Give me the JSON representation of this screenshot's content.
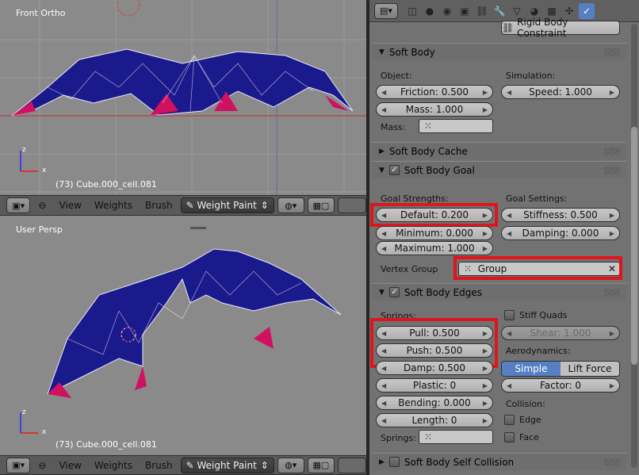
{
  "viewport_top": {
    "label": "Front Ortho",
    "object": "(73) Cube.000_cell.081",
    "axis_x": "x",
    "axis_z": "z"
  },
  "viewport_bottom": {
    "label": "User Persp",
    "object": "(73) Cube.000_cell.081",
    "axis_x": "x",
    "axis_z": "z"
  },
  "header": {
    "view": "View",
    "weights": "Weights",
    "brush": "Brush",
    "mode": "Weight Paint"
  },
  "props": {
    "rigid_constraint": "Rigid Body Constraint",
    "soft_body": {
      "title": "Soft Body",
      "object_label": "Object:",
      "simulation_label": "Simulation:",
      "friction": "Friction: 0.500",
      "mass": "Mass: 1.000",
      "speed": "Speed: 1.000",
      "mass_group_label": "Mass:"
    },
    "cache": {
      "title": "Soft Body Cache"
    },
    "goal": {
      "title": "Soft Body Goal",
      "strengths_label": "Goal Strengths:",
      "settings_label": "Goal Settings:",
      "default": "Default: 0.200",
      "minimum": "Minimum: 0.000",
      "maximum": "Maximum: 1.000",
      "stiffness": "Stiffness: 0.500",
      "damping": "Damping: 0.000",
      "vgroup_label": "Vertex Group",
      "vgroup_value": "Group"
    },
    "edges": {
      "title": "Soft Body Edges",
      "springs_label": "Springs:",
      "pull": "Pull: 0.500",
      "push": "Push: 0.500",
      "damp": "Damp: 0.500",
      "plastic": "Plastic: 0",
      "bending": "Bending: 0.000",
      "length": "Length: 0",
      "springs_group_label": "Springs:",
      "stiff_quads": "Stiff Quads",
      "shear": "Shear: 1.000",
      "aero_label": "Aerodynamics:",
      "simple": "Simple",
      "lift": "Lift Force",
      "factor": "Factor: 0",
      "collision_label": "Collision:",
      "edge": "Edge",
      "face": "Face"
    },
    "self_collision": {
      "title": "Soft Body Self Collision"
    }
  },
  "colors": {
    "accent": "#5680c2",
    "highlight": "#e0151b",
    "mesh": "#1a1a8c"
  },
  "icons": [
    "view3d-icon",
    "render-icon",
    "scene-icon",
    "world-icon",
    "object-icon",
    "constraint-icon",
    "modifier-icon",
    "data-icon",
    "material-icon",
    "texture-icon",
    "particles-icon",
    "physics-icon"
  ]
}
